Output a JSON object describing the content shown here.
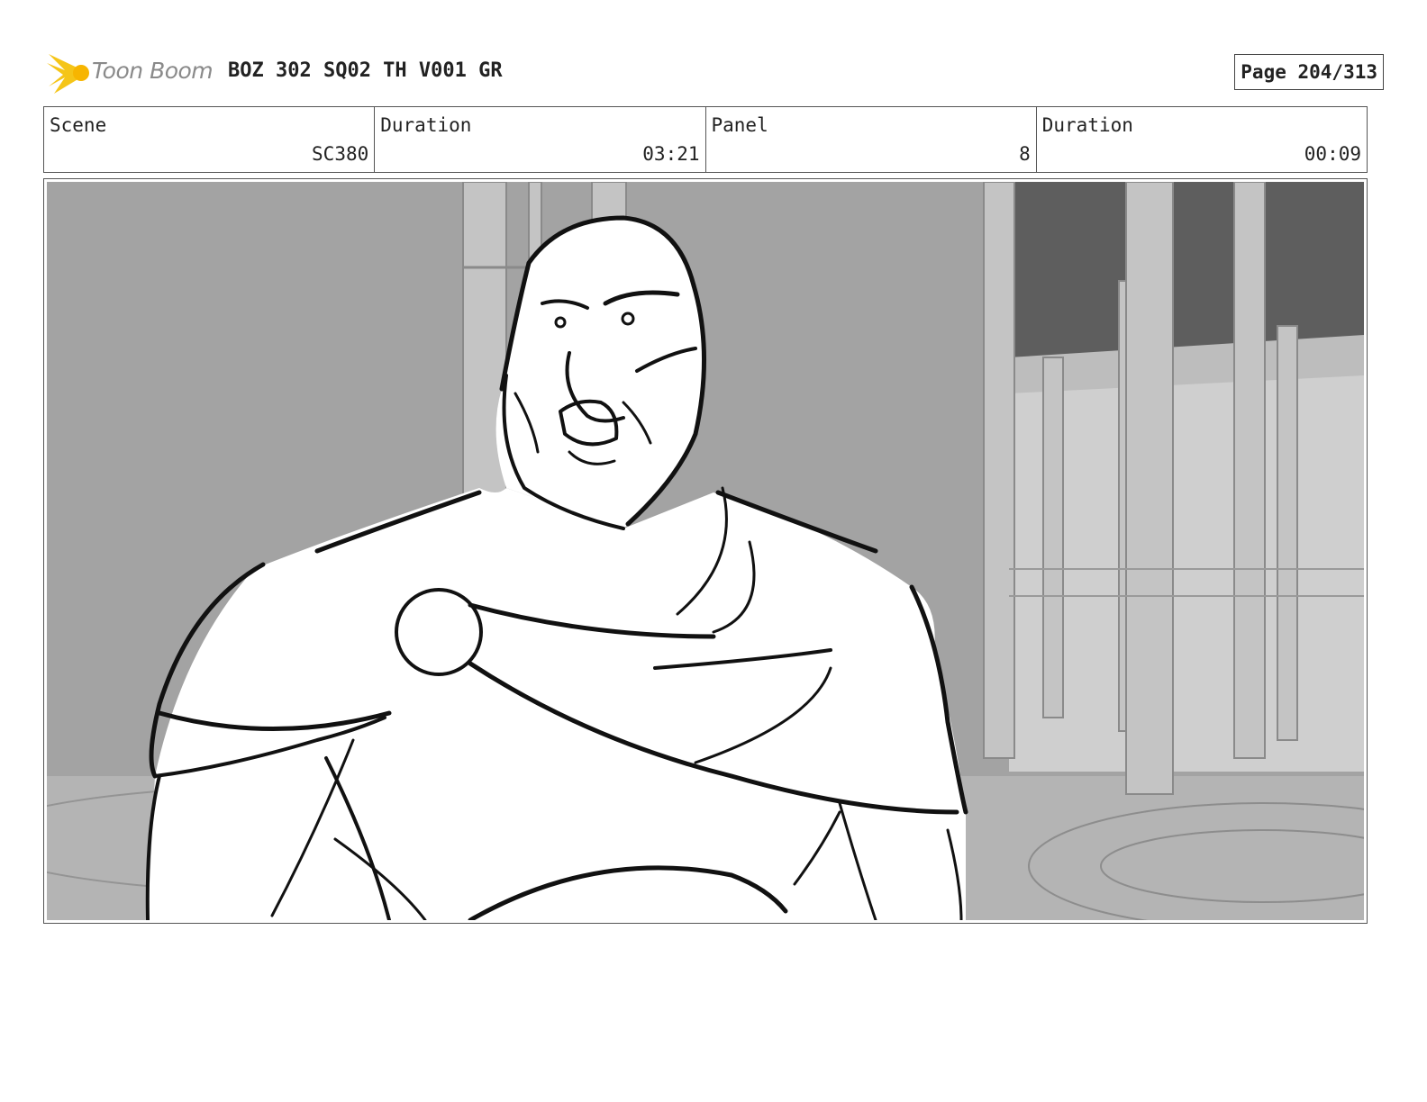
{
  "header": {
    "logo_text": "Toon Boom",
    "title": "BOZ 302 SQ02 TH V001 GR",
    "page": "Page 204/313"
  },
  "info": [
    {
      "label": "Scene",
      "value": "SC380"
    },
    {
      "label": "Duration",
      "value": "03:21"
    },
    {
      "label": "Panel",
      "value": "8"
    },
    {
      "label": "Duration",
      "value": "00:09"
    }
  ],
  "panel": {
    "image_description": "storyboard sketch of a bald, bearded muscular man shouting in a columned hall"
  },
  "colors": {
    "logo_flame": "#f5c518",
    "logo_text": "#8a8a8a",
    "background_gray": "#a3a3a3",
    "dark_window": "#5e5e5e"
  }
}
